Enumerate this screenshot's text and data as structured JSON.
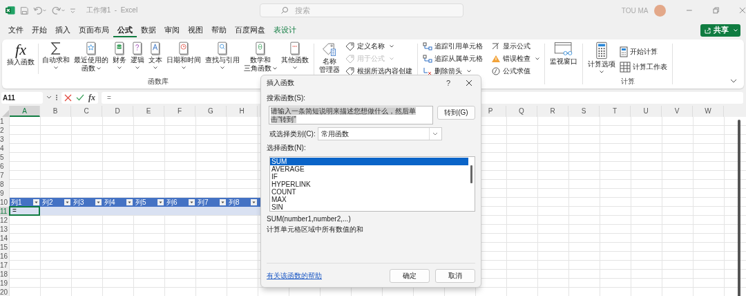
{
  "window": {
    "title": "工作簿1  -  Excel",
    "search_placeholder": "搜索",
    "user": "TOU MA"
  },
  "menu_tabs": [
    {
      "label": "文件",
      "selected": false,
      "kind": "normal"
    },
    {
      "label": "开始",
      "selected": false,
      "kind": "normal"
    },
    {
      "label": "插入",
      "selected": false,
      "kind": "normal"
    },
    {
      "label": "页面布局",
      "selected": false,
      "kind": "normal"
    },
    {
      "label": "公式",
      "selected": true,
      "kind": "normal"
    },
    {
      "label": "数据",
      "selected": false,
      "kind": "normal"
    },
    {
      "label": "审阅",
      "selected": false,
      "kind": "normal"
    },
    {
      "label": "视图",
      "selected": false,
      "kind": "normal"
    },
    {
      "label": "帮助",
      "selected": false,
      "kind": "normal"
    },
    {
      "label": "百度网盘",
      "selected": false,
      "kind": "normal"
    },
    {
      "label": "表设计",
      "selected": false,
      "kind": "contextual"
    }
  ],
  "share_button": "共享",
  "function_library": {
    "title": "函数库",
    "insert_icon": "fx",
    "insert_label": "插入函数",
    "items": [
      {
        "lines": [
          "自动求和"
        ],
        "kind": "sum"
      },
      {
        "lines": [
          "最近使用的",
          "函数"
        ],
        "kind": "star"
      },
      {
        "lines": [
          "财务"
        ],
        "kind": "database"
      },
      {
        "lines": [
          "逻辑"
        ],
        "kind": "question"
      },
      {
        "lines": [
          "文本"
        ],
        "kind": "text"
      },
      {
        "lines": [
          "日期和时间"
        ],
        "kind": "clock"
      },
      {
        "lines": [
          "查找与引用"
        ],
        "kind": "search"
      },
      {
        "lines": [
          "数学和",
          "三角函数"
        ],
        "kind": "theta"
      },
      {
        "lines": [
          "其他函数"
        ],
        "kind": "dots"
      }
    ]
  },
  "defined_names": {
    "manager": [
      "名称",
      "管理器"
    ],
    "items": [
      {
        "label": "定义名称",
        "dropdown": true,
        "disabled": false
      },
      {
        "label": "用于公式",
        "dropdown": true,
        "disabled": true
      },
      {
        "label": "根据所选内容创建",
        "dropdown": false,
        "disabled": false
      }
    ]
  },
  "formula_auditing": {
    "items": [
      {
        "label": "追踪引用单元格",
        "dropdown": false,
        "kind": "trace"
      },
      {
        "label": "追踪从属单元格",
        "dropdown": false,
        "kind": "trace"
      },
      {
        "label": "删除箭头",
        "dropdown": true,
        "kind": "remove"
      },
      {
        "label": "显示公式",
        "dropdown": false,
        "kind": "show"
      },
      {
        "label": "错误检查",
        "dropdown": true,
        "kind": "warning"
      },
      {
        "label": "公式求值",
        "dropdown": false,
        "kind": "evaluate"
      }
    ],
    "watch": "监视窗口"
  },
  "calculation": {
    "title": "计算",
    "options": "计算选项",
    "items": [
      {
        "label": "开始计算",
        "kind": "calc"
      },
      {
        "label": "计算工作表",
        "kind": "sheet"
      }
    ]
  },
  "formula_bar": {
    "name_box": "A11",
    "formula": "=",
    "fx": "fx"
  },
  "sheet": {
    "columns_left": [
      {
        "label": "A",
        "selected": true
      },
      {
        "label": "B",
        "selected": false
      },
      {
        "label": "C",
        "selected": false
      },
      {
        "label": "D",
        "selected": false
      },
      {
        "label": "E",
        "selected": false
      },
      {
        "label": "F",
        "selected": false
      },
      {
        "label": "G",
        "selected": false
      },
      {
        "label": "H",
        "selected": false
      }
    ],
    "columns_right": [
      {
        "label": "P",
        "selected": false
      },
      {
        "label": "Q",
        "selected": false
      },
      {
        "label": "R",
        "selected": false
      },
      {
        "label": "S",
        "selected": false
      },
      {
        "label": "T",
        "selected": false
      },
      {
        "label": "U",
        "selected": false
      },
      {
        "label": "V",
        "selected": false
      },
      {
        "label": "W",
        "selected": false
      }
    ],
    "rows": [
      {
        "label": "1",
        "selected": false,
        "kind": "plain"
      },
      {
        "label": "2",
        "selected": false,
        "kind": "plain"
      },
      {
        "label": "3",
        "selected": false,
        "kind": "plain"
      },
      {
        "label": "4",
        "selected": false,
        "kind": "plain"
      },
      {
        "label": "5",
        "selected": false,
        "kind": "plain"
      },
      {
        "label": "6",
        "selected": false,
        "kind": "plain"
      },
      {
        "label": "7",
        "selected": false,
        "kind": "plain"
      },
      {
        "label": "8",
        "selected": false,
        "kind": "plain"
      },
      {
        "label": "9",
        "selected": false,
        "kind": "plain"
      },
      {
        "label": "10",
        "selected": false,
        "kind": "table-header"
      },
      {
        "label": "11",
        "selected": true,
        "kind": "table-body"
      },
      {
        "label": "12",
        "selected": false,
        "kind": "plain"
      },
      {
        "label": "13",
        "selected": false,
        "kind": "plain"
      },
      {
        "label": "14",
        "selected": false,
        "kind": "plain"
      },
      {
        "label": "15",
        "selected": false,
        "kind": "plain"
      },
      {
        "label": "16",
        "selected": false,
        "kind": "plain"
      },
      {
        "label": "17",
        "selected": false,
        "kind": "plain"
      },
      {
        "label": "18",
        "selected": false,
        "kind": "plain"
      },
      {
        "label": "19",
        "selected": false,
        "kind": "plain"
      },
      {
        "label": "20",
        "selected": false,
        "kind": "plain"
      }
    ],
    "table": {
      "headers": [
        "列1",
        "列2",
        "列3",
        "列4",
        "列5",
        "列6",
        "列7",
        "列8"
      ],
      "active_cell": "="
    }
  },
  "dialog": {
    "title": "插入函数",
    "help": "?",
    "search_label": "搜索函数(S):",
    "search_value": "请输入一条简短说明来描述您想做什么，然后单击“转到”",
    "go_button": "转到(G)",
    "category_label": "或选择类别(C):",
    "category_value": "常用函数",
    "list_label": "选择函数(N):",
    "functions": [
      {
        "name": "SUM",
        "selected": true
      },
      {
        "name": "AVERAGE",
        "selected": false
      },
      {
        "name": "IF",
        "selected": false
      },
      {
        "name": "HYPERLINK",
        "selected": false
      },
      {
        "name": "COUNT",
        "selected": false
      },
      {
        "name": "MAX",
        "selected": false
      },
      {
        "name": "SIN",
        "selected": false
      }
    ],
    "signature": "SUM(number1,number2,...)",
    "description": "计算单元格区域中所有数值的和",
    "help_link": "有关该函数的帮助",
    "ok_button": "确定",
    "cancel_button": "取消"
  }
}
